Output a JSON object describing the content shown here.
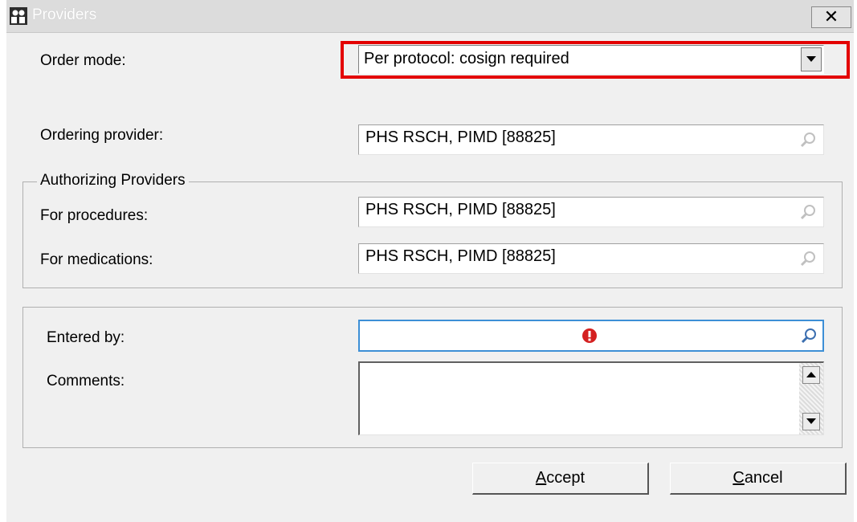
{
  "window": {
    "title": "Providers",
    "close_label": "✕"
  },
  "order_mode": {
    "label": "Order mode:",
    "value": "Per protocol: cosign required"
  },
  "ordering_provider": {
    "label": "Ordering provider:",
    "value": "PHS RSCH, PIMD [88825]"
  },
  "authorizing": {
    "title": "Authorizing Providers",
    "procedures": {
      "label": "For procedures:",
      "value": "PHS RSCH, PIMD [88825]"
    },
    "medications": {
      "label": "For medications:",
      "value": "PHS RSCH, PIMD [88825]"
    }
  },
  "entered_by": {
    "label": "Entered by:",
    "value": ""
  },
  "comments": {
    "label": "Comments:",
    "value": ""
  },
  "buttons": {
    "accept_first": "A",
    "accept_rest": "ccept",
    "cancel_first": "C",
    "cancel_rest": "ancel"
  },
  "colors": {
    "highlight": "#e30000",
    "focus_border": "#3c8fd6",
    "error_icon": "#d42020"
  }
}
